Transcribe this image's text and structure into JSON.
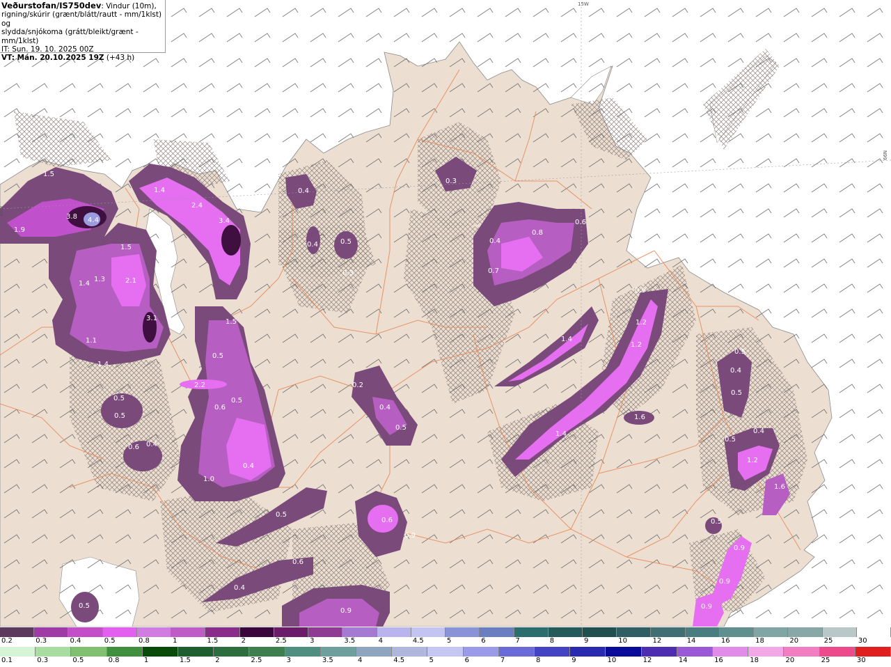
{
  "header": {
    "title_bold": "Veðurstofan/IS750dev",
    "title_rest": ": Vindur (10m),",
    "line2": "rigning/skúrir (grænt/blátt/rautt - mm/1klst) og",
    "line3": "slydda/snjókoma (grátt/bleikt/grænt - mm/1klst)",
    "it": "IT: Sun. 19. 10. 2025 00Z",
    "vt_bold": "VT: Mán. 20.10.2025 19Z",
    "vt_rest": " (+43 h)"
  },
  "map": {
    "edge_labels": [
      "15W",
      "66N",
      "66N"
    ],
    "value_labels": [
      "1.5",
      "1.4",
      "1.9",
      "3.8",
      "4.4",
      "2.4",
      "3.4",
      "1.5",
      "1.4",
      "1.3",
      "2.1",
      "3.1",
      "1.1",
      "1.4",
      "0.5",
      "1.5",
      "0.5",
      "2.2",
      "0.6",
      "0.5",
      "0.5",
      "0.6",
      "0.4",
      "0.4",
      "1.0",
      "0.5",
      "0.6",
      "0.4",
      "0.5",
      "0.4",
      "0.5",
      "0.4",
      "0.3",
      "0.2",
      "0.4",
      "0.5",
      "0.6",
      "0.9",
      "0.3",
      "0.4",
      "0.8",
      "0.6",
      "0.7",
      "0.9",
      "1.2",
      "1.2",
      "1.4",
      "1.4",
      "1.6",
      "0.5",
      "0.4",
      "0.5",
      "0.5",
      "0.4",
      "1.2",
      "1.6",
      "0.5",
      "0.9",
      "0.9",
      "0.9",
      "0.9"
    ],
    "colors": {
      "land": "#ecdfd2",
      "sea": "#ffffff",
      "road": "#e98a5a",
      "precip_light": "#7a4a7a",
      "precip_mid": "#b25fbf",
      "precip_high": "#e56ff0",
      "precip_peak": "#3a0e3a",
      "wind_barb": "#666666"
    }
  },
  "legend_top": {
    "labels": [
      "0.2",
      "0.3",
      "0.4",
      "0.5",
      "0.8",
      "1",
      "1.5",
      "2",
      "2.5",
      "3",
      "3.5",
      "4",
      "4.5",
      "5",
      "6",
      "7",
      "8",
      "9",
      "10",
      "12",
      "14",
      "16",
      "18",
      "20",
      "25",
      "30"
    ],
    "colors": [
      "#5d3a5d",
      "#a03aa7",
      "#c44dc9",
      "#e25ff0",
      "#d27be0",
      "#c05cc8",
      "#8b2c8b",
      "#3b063b",
      "#6a1c6a",
      "#8f3a93",
      "#a57ad2",
      "#b9b4ee",
      "#c4c4f2",
      "#8a93d8",
      "#6a7ec2",
      "#2c6e6e",
      "#245a5a",
      "#1f4f4f",
      "#2f5f63",
      "#3f6f73",
      "#4a7d7f",
      "#5f8f8f",
      "#7fa5a5",
      "#8aa7a7",
      "#b8c8c8",
      "#ffffff"
    ]
  },
  "legend_bottom": {
    "labels": [
      "0.1",
      "0.3",
      "0.5",
      "0.8",
      "1",
      "1.5",
      "2",
      "2.5",
      "3",
      "3.5",
      "4",
      "4.5",
      "5",
      "6",
      "7",
      "8",
      "9",
      "10",
      "12",
      "14",
      "16",
      "18",
      "20",
      "25",
      "30"
    ],
    "colors": [
      "#d6f5d6",
      "#a8dca0",
      "#80c070",
      "#3f8f3f",
      "#0a4a0a",
      "#1f5f2f",
      "#2e6e3e",
      "#3f7f4f",
      "#4f8f7f",
      "#6f9f9f",
      "#8fa5c0",
      "#b0b7dc",
      "#c6c6f2",
      "#9a9ae8",
      "#6a6ad8",
      "#4343c3",
      "#2a2ab0",
      "#0b0b9a",
      "#4d2db0",
      "#9a5ad8",
      "#e08ce8",
      "#f2a8e6",
      "#f07ec0",
      "#ec4a8a",
      "#e02020"
    ]
  }
}
